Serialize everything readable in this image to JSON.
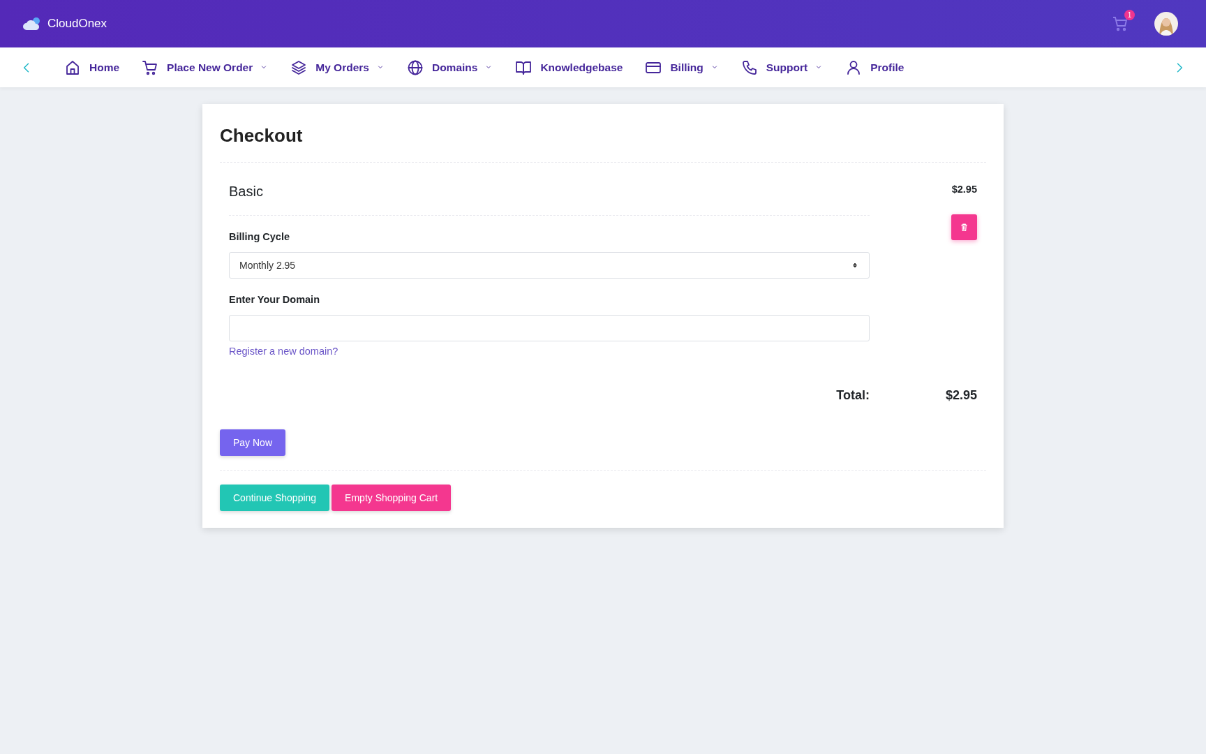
{
  "header": {
    "brand": "CloudOnex",
    "cart_count": "1"
  },
  "nav": {
    "items": [
      {
        "label": "Home",
        "kind": "home",
        "dropdown": false
      },
      {
        "label": "Place New Order",
        "kind": "cart",
        "dropdown": true
      },
      {
        "label": "My Orders",
        "kind": "layers",
        "dropdown": true
      },
      {
        "label": "Domains",
        "kind": "globe",
        "dropdown": true
      },
      {
        "label": "Knowledgebase",
        "kind": "book",
        "dropdown": false
      },
      {
        "label": "Billing",
        "kind": "card",
        "dropdown": true
      },
      {
        "label": "Support",
        "kind": "phone",
        "dropdown": true
      },
      {
        "label": "Profile",
        "kind": "user",
        "dropdown": false
      }
    ]
  },
  "checkout": {
    "title": "Checkout",
    "items": [
      {
        "name": "Basic",
        "price": "$2.95",
        "billing_label": "Billing Cycle",
        "billing_value": "Monthly 2.95",
        "domain_label": "Enter Your Domain",
        "domain_link": "Register a new domain?"
      }
    ],
    "total_label": "Total:",
    "total": "$2.95",
    "pay_button": "Pay Now",
    "buttons": [
      {
        "label": "Continue Shopping",
        "kind": "continue"
      },
      {
        "label": "Empty Shopping Cart",
        "kind": "empty"
      }
    ]
  }
}
